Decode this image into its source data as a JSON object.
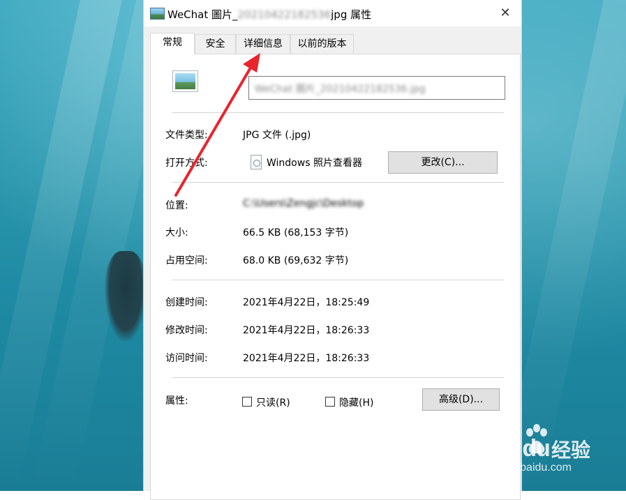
{
  "window": {
    "title_prefix": "WeChat 圖片_",
    "title_hidden": "20210422182536",
    "title_suffix": "jpg 属性",
    "close_glyph": "✕"
  },
  "tabs": [
    {
      "label": "常规",
      "active": true
    },
    {
      "label": "安全",
      "active": false
    },
    {
      "label": "详细信息",
      "active": false
    },
    {
      "label": "以前的版本",
      "active": false
    }
  ],
  "general": {
    "file_name": "WeChat 圖片_20210422182536.jpg",
    "file_type_label": "文件类型:",
    "file_type_value": "JPG 文件 (.jpg)",
    "open_with_label": "打开方式:",
    "open_with_value": "Windows 照片查看器",
    "change_button": "更改(C)...",
    "location_label": "位置:",
    "location_value": "C:\\Users\\Zengjc\\Desktop",
    "size_label": "大小:",
    "size_value": "66.5 KB (68,153 字节)",
    "disk_size_label": "占用空间:",
    "disk_size_value": "68.0 KB (69,632 字节)",
    "created_label": "创建时间:",
    "created_value": "2021年4月22日，18:25:49",
    "modified_label": "修改时间:",
    "modified_value": "2021年4月22日，18:26:33",
    "accessed_label": "访问时间:",
    "accessed_value": "2021年4月22日，18:26:33",
    "attributes_label": "属性:",
    "readonly_label": "只读(R)",
    "readonly_checked": false,
    "hidden_label": "隐藏(H)",
    "hidden_checked": false,
    "advanced_button": "高级(D)..."
  },
  "watermark": {
    "brand": "Bai du",
    "product": "经验",
    "url": "jingyan.baidu.com"
  },
  "annotation_color": "#e8252d",
  "icons": [
    "image-file-icon",
    "photo-viewer-icon",
    "close-icon",
    "red-arrow-annotation"
  ]
}
